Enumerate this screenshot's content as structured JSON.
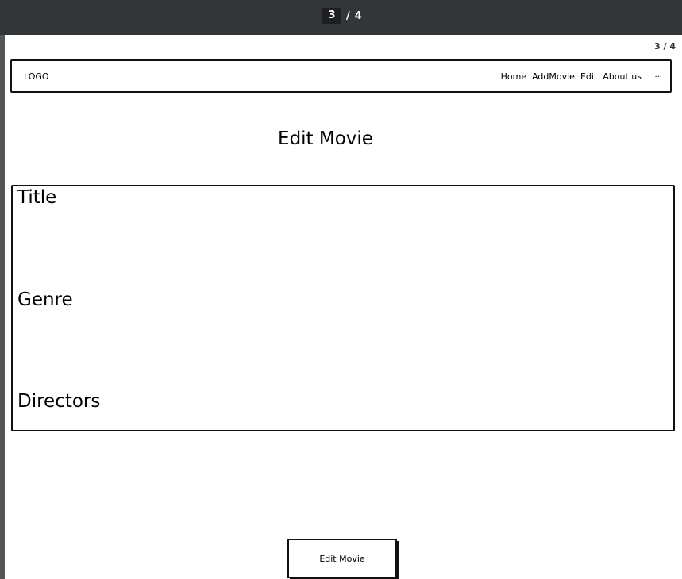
{
  "viewer": {
    "current_page": "3",
    "separator": "/",
    "total_pages": "4"
  },
  "page": {
    "page_index": "3 / 4"
  },
  "navbar": {
    "logo": "LOGO",
    "links": [
      "Home",
      "AddMovie",
      "Edit",
      "About us"
    ],
    "more": "..."
  },
  "main": {
    "title": "Edit Movie",
    "fields": [
      "Title",
      "Genre",
      "Directors"
    ],
    "submit_label": "Edit Movie"
  }
}
